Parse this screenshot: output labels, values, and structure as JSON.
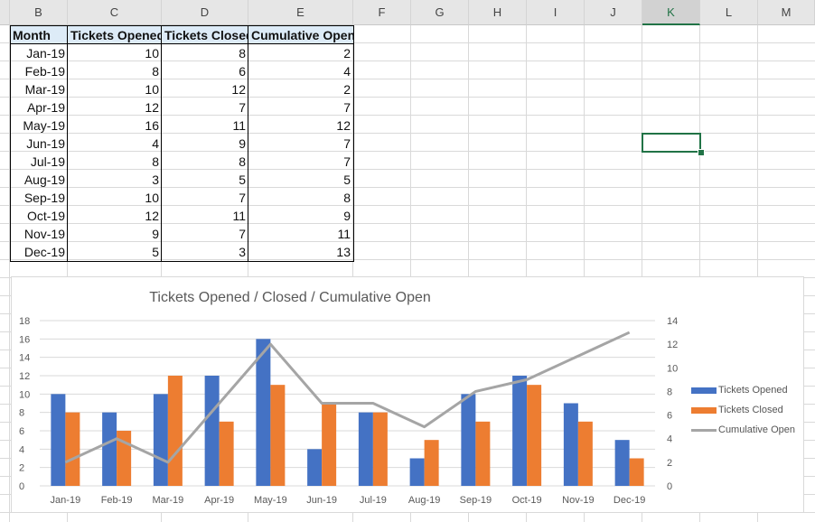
{
  "spreadsheet": {
    "columns": [
      "",
      "B",
      "C",
      "D",
      "E",
      "F",
      "G",
      "H",
      "I",
      "J",
      "K",
      "L",
      "M"
    ],
    "selected_column": "K",
    "selected_cell": "K7",
    "table": {
      "headers": [
        "Month",
        "Tickets Opened",
        "Tickets Closed",
        "Cumulative Open"
      ],
      "rows": [
        [
          "Jan-19",
          "10",
          "8",
          "2"
        ],
        [
          "Feb-19",
          "8",
          "6",
          "4"
        ],
        [
          "Mar-19",
          "10",
          "12",
          "2"
        ],
        [
          "Apr-19",
          "12",
          "7",
          "7"
        ],
        [
          "May-19",
          "16",
          "11",
          "12"
        ],
        [
          "Jun-19",
          "4",
          "9",
          "7"
        ],
        [
          "Jul-19",
          "8",
          "8",
          "7"
        ],
        [
          "Aug-19",
          "3",
          "5",
          "5"
        ],
        [
          "Sep-19",
          "10",
          "7",
          "8"
        ],
        [
          "Oct-19",
          "12",
          "11",
          "9"
        ],
        [
          "Nov-19",
          "9",
          "7",
          "11"
        ],
        [
          "Dec-19",
          "5",
          "3",
          "13"
        ]
      ],
      "header_fill": "#ddebf7"
    }
  },
  "chart_data": {
    "type": "bar",
    "title": "Tickets Opened / Closed / Cumulative Open",
    "categories": [
      "Jan-19",
      "Feb-19",
      "Mar-19",
      "Apr-19",
      "May-19",
      "Jun-19",
      "Jul-19",
      "Aug-19",
      "Sep-19",
      "Oct-19",
      "Nov-19",
      "Dec-19"
    ],
    "series": [
      {
        "name": "Tickets Opened",
        "type": "bar",
        "axis": "primary",
        "color": "#4472c4",
        "values": [
          10,
          8,
          10,
          12,
          16,
          4,
          8,
          3,
          10,
          12,
          9,
          5
        ]
      },
      {
        "name": "Tickets Closed",
        "type": "bar",
        "axis": "primary",
        "color": "#ed7d31",
        "values": [
          8,
          6,
          12,
          7,
          11,
          9,
          8,
          5,
          7,
          11,
          7,
          3
        ]
      },
      {
        "name": "Cumulative Open",
        "type": "line",
        "axis": "secondary",
        "color": "#a5a5a5",
        "values": [
          2,
          4,
          2,
          7,
          12,
          7,
          7,
          5,
          8,
          9,
          11,
          13
        ]
      }
    ],
    "primary_axis": {
      "ylim": [
        0,
        18
      ],
      "ticks": [
        "0",
        "2",
        "4",
        "6",
        "8",
        "10",
        "12",
        "14",
        "16",
        "18"
      ]
    },
    "secondary_axis": {
      "ylim": [
        0,
        14
      ],
      "ticks": [
        "0",
        "2",
        "4",
        "6",
        "8",
        "10",
        "12",
        "14"
      ]
    },
    "grid": true,
    "legend": "right",
    "xlabel": "",
    "ylabel": ""
  }
}
